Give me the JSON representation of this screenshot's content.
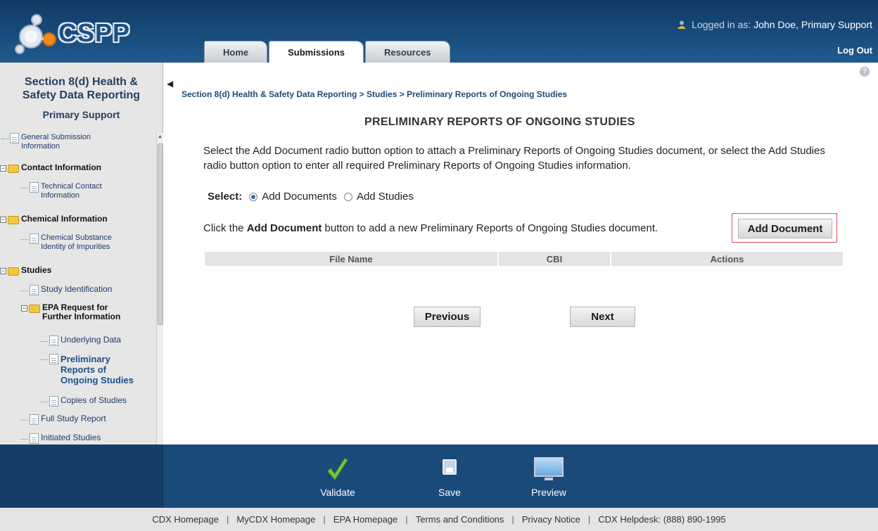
{
  "header": {
    "logo_text": "CSPP",
    "tabs": [
      "Home",
      "Submissions",
      "Resources"
    ],
    "active_tab": "Submissions",
    "login_prefix": "Logged in as:",
    "login_user": "John Doe, Primary Support",
    "logout_label": "Log Out",
    "user_icon": "user-icon"
  },
  "sidebar": {
    "title_line1": "Section 8(d) Health &",
    "title_line2": "Safety Data Reporting",
    "role": "Primary Support",
    "tree": {
      "general_submission_1": "General Submission",
      "general_submission_2": "Information",
      "contact_information": "Contact Information",
      "technical_contact_1": "Technical Contact",
      "technical_contact_2": "Information",
      "chemical_information": "Chemical Information",
      "chemical_substance_1": "Chemical Substance",
      "chemical_substance_2": "Identity of Impurities",
      "studies": "Studies",
      "study_identification": "Study Identification",
      "epa_request_1": "EPA Request for",
      "epa_request_2": "Further Information",
      "underlying_data": "Underlying Data",
      "preliminary_1": "Preliminary",
      "preliminary_2": "Reports of",
      "preliminary_3": "Ongoing Studies",
      "copies_of_studies": "Copies of Studies",
      "full_study_report": "Full Study Report",
      "initiated_studies": "Initiated Studies"
    }
  },
  "main": {
    "breadcrumb": "Section 8(d) Health & Safety Data Reporting > Studies > Preliminary Reports of Ongoing Studies",
    "title": "PRELIMINARY REPORTS OF ONGOING STUDIES",
    "instructions": "Select the Add Document radio button option to attach a Preliminary Reports of Ongoing Studies document, or select the Add Studies radio button option to enter all required Preliminary Reports of Ongoing Studies information.",
    "select_label": "Select:",
    "radio_add_documents": "Add Documents",
    "radio_add_studies": "Add Studies",
    "selected_option": "Add Documents",
    "click_prefix": "Click the",
    "click_bold": "Add Document",
    "click_suffix": "button to add a new Preliminary Reports of Ongoing Studies document.",
    "add_document_button": "Add Document",
    "table_headers": [
      "File Name",
      "CBI",
      "Actions"
    ],
    "previous_button": "Previous",
    "next_button": "Next"
  },
  "toolbar": {
    "validate": "Validate",
    "save": "Save",
    "preview": "Preview"
  },
  "footer": {
    "links": [
      "CDX Homepage",
      "MyCDX Homepage",
      "EPA Homepage",
      "Terms and Conditions",
      "Privacy Notice",
      "CDX Helpdesk: (888) 890-1995"
    ]
  },
  "colors": {
    "header_bg": "#1a4d7e",
    "bottombar_bg": "#1a4a79",
    "highlight_border": "#e05060",
    "link_blue": "#1e4a78"
  }
}
